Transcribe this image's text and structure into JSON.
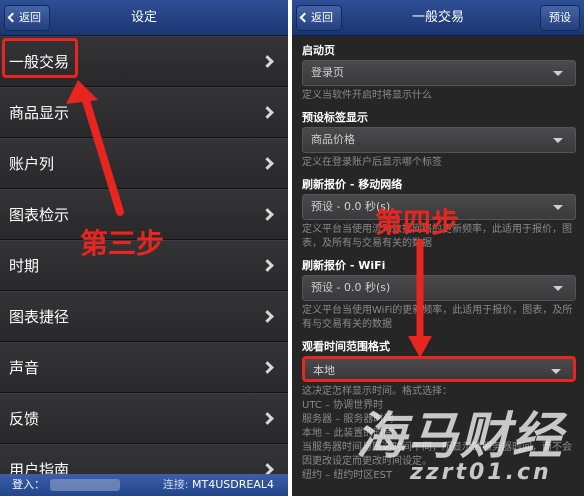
{
  "left": {
    "back_label": "返回",
    "title": "设定",
    "menu": [
      {
        "label": "一般交易"
      },
      {
        "label": "商品显示"
      },
      {
        "label": "账户列"
      },
      {
        "label": "图表检示"
      },
      {
        "label": "时期"
      },
      {
        "label": "图表捷径"
      },
      {
        "label": "声音"
      },
      {
        "label": "反馈"
      },
      {
        "label": "用户指南"
      }
    ],
    "status": {
      "login_label": "登入：",
      "conn_label": "连接:",
      "conn_value": "MT4USDREAL4"
    }
  },
  "right": {
    "back_label": "返回",
    "title": "一般交易",
    "preset_label": "预设",
    "groups": [
      {
        "title": "启动页",
        "value": "登录页",
        "desc": "定义当软件开启时将显示什么"
      },
      {
        "title": "预设标签显示",
        "value": "商品价格",
        "desc": "定义在登录账户后显示哪个标签"
      },
      {
        "title": "刷新报价 - 移动网络",
        "value": "预设 - 0.0 秒(s)",
        "desc": "定义平台当使用流动数据网络的更新频率，此适用于报价，图表，及所有与交易有关的数据"
      },
      {
        "title": "刷新报价 - WiFi",
        "value": "预设 - 0.0 秒(s)",
        "desc": "定义平台当使用WiFi的更新频率，此适用于报价，图表，及所有与交易有关的数据"
      },
      {
        "title": "观看时间范围格式",
        "value": "本地",
        "desc": "这决定怎样显示时间。格式选择：\nUTC – 协调世界时\n服务器 – 服务器时间\n本地 – 此装置的时间\n当服务器时间与所选时间不同，所显示的服务器时间，而不会因更改设定而更改时间设定。\n纽约 – 纽约时区EST"
      }
    ]
  },
  "annotations": {
    "step3": "第三步",
    "step4": "第四步"
  },
  "watermark": {
    "main": "海马财经",
    "url": "zzrt01.cn"
  },
  "colors": {
    "nav_blue": "#1b3570",
    "annotation_red": "#e8251f",
    "list_bg": "#2c2c2e"
  }
}
